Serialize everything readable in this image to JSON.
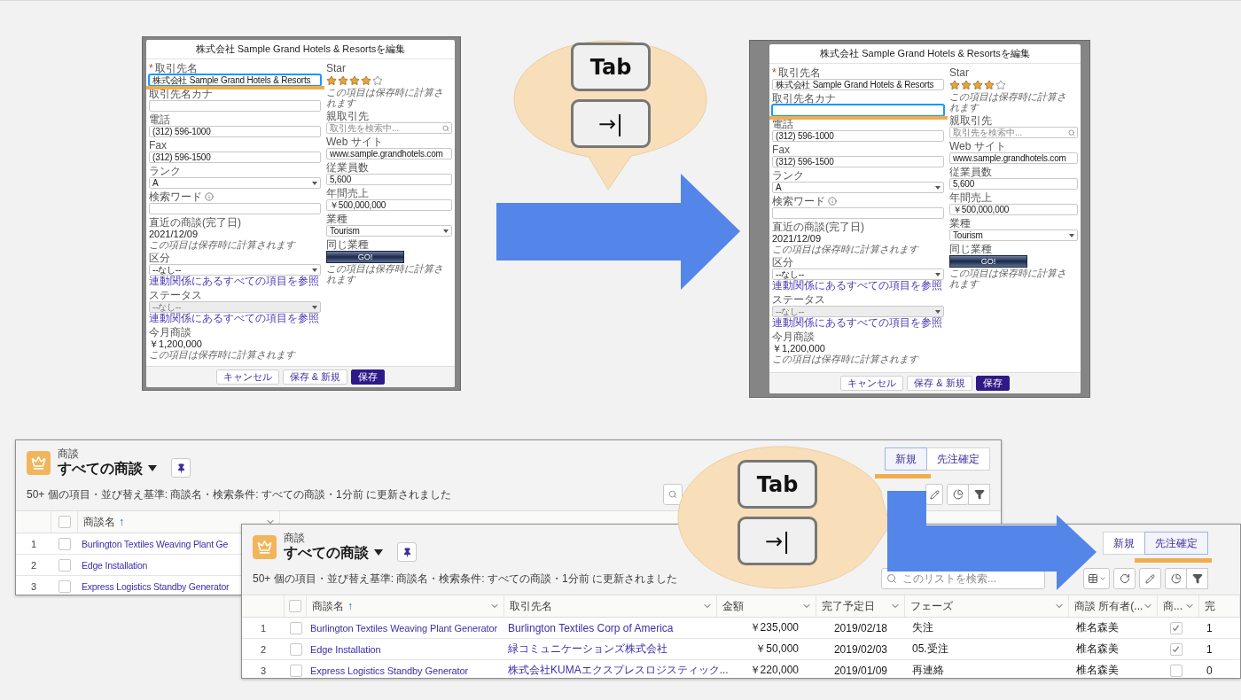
{
  "dialogs": [
    {
      "title": "株式会社 Sample Grand Hotels & Resortsを編集",
      "left_fields": [
        {
          "kind": "input",
          "label": "取引先名",
          "required_mark": "*",
          "value": "株式会社 Sample Grand Hotels & Resorts",
          "focused": true,
          "disabled": false
        },
        {
          "kind": "input",
          "label": "取引先名カナ",
          "focused": false,
          "disabled": false
        },
        {
          "kind": "input",
          "label": "電話",
          "value": "(312) 596-1000",
          "focused": false,
          "disabled": false
        },
        {
          "kind": "input",
          "label": "Fax",
          "value": "(312) 596-1500",
          "focused": false,
          "disabled": false
        },
        {
          "kind": "select",
          "label": "ランク",
          "value": "A",
          "focused": false,
          "disabled": false
        },
        {
          "kind": "input",
          "label": "検索ワード",
          "info": true,
          "focused": false,
          "disabled": false
        },
        {
          "kind": "readonly",
          "label": "直近の商談(完了日)",
          "value": "2021/12/09",
          "note": "この項目は保存時に計算されます"
        },
        {
          "kind": "select",
          "label": "区分",
          "value": "--なし--",
          "link": "連動関係にあるすべての項目を参照",
          "focused": false,
          "disabled": false
        },
        {
          "kind": "select",
          "label": "ステータス",
          "value": "--なし--",
          "link": "連動関係にあるすべての項目を参照",
          "focused": false,
          "disabled": true
        },
        {
          "kind": "readonly",
          "label": "今月商談",
          "value": "￥1,200,000",
          "note": "この項目は保存時に計算されます"
        }
      ],
      "right_fields": [
        {
          "kind": "stars",
          "label": "Star",
          "stars": 4,
          "note": "この項目は保存時に計算されます"
        },
        {
          "kind": "lookup",
          "label": "親取引先",
          "placeholder": "取引先を検索中...",
          "focused": false,
          "disabled": false
        },
        {
          "kind": "input",
          "label": "Web サイト",
          "value": "www.sample.grandhotels.com",
          "focused": false,
          "disabled": false
        },
        {
          "kind": "input",
          "label": "従業員数",
          "value": "5,600",
          "focused": false,
          "disabled": false
        },
        {
          "kind": "input",
          "label": "年間売上",
          "value": "￥500,000,000",
          "focused": false,
          "disabled": false
        },
        {
          "kind": "select",
          "label": "業種",
          "value": "Tourism",
          "focused": false,
          "disabled": false
        },
        {
          "kind": "button",
          "label": "同じ業種",
          "value": "GO!",
          "note": "この項目は保存時に計算されます"
        }
      ],
      "footer_buttons": [
        {
          "label": "キャンセル",
          "kind": "neutral"
        },
        {
          "label": "保存 & 新規",
          "kind": "neutral"
        },
        {
          "label": "保存",
          "kind": "brand"
        }
      ]
    },
    {
      "title": "株式会社 Sample Grand Hotels & Resortsを編集",
      "left_fields": [
        {
          "kind": "input",
          "label": "取引先名",
          "required_mark": "*",
          "value": "株式会社 Sample Grand Hotels & Resorts",
          "focused": false,
          "disabled": false
        },
        {
          "kind": "input",
          "label": "取引先名カナ",
          "focused": true,
          "disabled": false
        },
        {
          "kind": "input",
          "label": "電話",
          "value": "(312) 596-1000",
          "focused": false,
          "disabled": false
        },
        {
          "kind": "input",
          "label": "Fax",
          "value": "(312) 596-1500",
          "focused": false,
          "disabled": false
        },
        {
          "kind": "select",
          "label": "ランク",
          "value": "A",
          "focused": false,
          "disabled": false
        },
        {
          "kind": "input",
          "label": "検索ワード",
          "info": true,
          "focused": false,
          "disabled": false
        },
        {
          "kind": "readonly",
          "label": "直近の商談(完了日)",
          "value": "2021/12/09",
          "note": "この項目は保存時に計算されます"
        },
        {
          "kind": "select",
          "label": "区分",
          "value": "--なし--",
          "link": "連動関係にあるすべての項目を参照",
          "focused": false,
          "disabled": false
        },
        {
          "kind": "select",
          "label": "ステータス",
          "value": "--なし--",
          "link": "連動関係にあるすべての項目を参照",
          "focused": false,
          "disabled": true
        },
        {
          "kind": "readonly",
          "label": "今月商談",
          "value": "￥1,200,000",
          "note": "この項目は保存時に計算されます"
        }
      ],
      "right_fields": [
        {
          "kind": "stars",
          "label": "Star",
          "stars": 4,
          "note": "この項目は保存時に計算されます"
        },
        {
          "kind": "lookup",
          "label": "親取引先",
          "placeholder": "取引先を検索中...",
          "focused": false,
          "disabled": false
        },
        {
          "kind": "input",
          "label": "Web サイト",
          "value": "www.sample.grandhotels.com",
          "focused": false,
          "disabled": false
        },
        {
          "kind": "input",
          "label": "従業員数",
          "value": "5,600",
          "focused": false,
          "disabled": false
        },
        {
          "kind": "input",
          "label": "年間売上",
          "value": "￥500,000,000",
          "focused": false,
          "disabled": false
        },
        {
          "kind": "select",
          "label": "業種",
          "value": "Tourism",
          "focused": false,
          "disabled": false
        },
        {
          "kind": "button",
          "label": "同じ業種",
          "value": "GO!",
          "note": "この項目は保存時に計算されます"
        }
      ],
      "footer_buttons": [
        {
          "label": "キャンセル",
          "kind": "neutral"
        },
        {
          "label": "保存 & 新規",
          "kind": "neutral"
        },
        {
          "label": "保存",
          "kind": "brand"
        }
      ]
    }
  ],
  "bubbles": [
    {
      "keys": [
        {
          "label": "Tab",
          "kind": "word"
        },
        {
          "label": "→|",
          "kind": "symbol"
        }
      ]
    },
    {
      "keys": [
        {
          "label": "Tab",
          "kind": "word"
        },
        {
          "label": "→|",
          "kind": "symbol"
        }
      ]
    }
  ],
  "list_views": [
    {
      "object_label": "商談",
      "title": "すべての商談",
      "summary": "50+ 個の項目・並び替え基準: 商談名・検索条件: すべての商談・1分前 に更新されました",
      "buttons": [
        {
          "label": "新規",
          "focused": true
        },
        {
          "label": "先注確定",
          "focused": false
        }
      ],
      "select_all": {
        "checked": false
      },
      "columns": [
        {
          "label": "商談名",
          "sort": "↑",
          "kind": "link"
        }
      ],
      "rows": [
        {
          "number": "1",
          "selected": false,
          "cells": [
            "Burlington Textiles Weaving Plant Ge"
          ]
        },
        {
          "number": "2",
          "selected": false,
          "cells": [
            "Edge Installation"
          ]
        },
        {
          "number": "3",
          "selected": false,
          "cells": [
            "Express Logistics Standby Generator"
          ]
        }
      ]
    },
    {
      "object_label": "商談",
      "title": "すべての商談",
      "summary": "50+ 個の項目・並び替え基準: 商談名・検索条件: すべての商談・1分前 に更新されました",
      "buttons": [
        {
          "label": "新規",
          "focused": false
        },
        {
          "label": "先注確定",
          "focused": true
        }
      ],
      "search": {
        "placeholder": "このリストを検索..."
      },
      "select_all": {
        "checked": false
      },
      "columns": [
        {
          "label": "商談名",
          "sort": "↑",
          "kind": "link"
        },
        {
          "label": "取引先名",
          "kind": "link"
        },
        {
          "label": "金額",
          "kind": "amount"
        },
        {
          "label": "完了予定日",
          "kind": "date"
        },
        {
          "label": "フェーズ",
          "kind": "text"
        },
        {
          "label": "商談 所有者(...",
          "kind": "text"
        },
        {
          "label": "商...",
          "kind": "check"
        },
        {
          "label": "完",
          "kind": "text"
        }
      ],
      "rows": [
        {
          "number": "1",
          "selected": false,
          "cells": [
            "Burlington Textiles Weaving Plant Generator",
            "Burlington Textiles Corp of America",
            "￥235,000",
            "2019/02/18",
            "失注",
            "椎名森美",
            true,
            "1"
          ]
        },
        {
          "number": "2",
          "selected": false,
          "cells": [
            "Edge Installation",
            "緑コミュニケーションズ株式会社",
            "￥50,000",
            "2019/02/03",
            "05.受注",
            "椎名森美",
            true,
            "1"
          ]
        },
        {
          "number": "3",
          "selected": false,
          "cells": [
            "Express Logistics Standby Generator",
            "株式会社KUMAエクスプレスロジスティック...",
            "￥220,000",
            "2019/01/09",
            "再連絡",
            "椎名森美",
            false,
            "0"
          ]
        }
      ]
    }
  ]
}
